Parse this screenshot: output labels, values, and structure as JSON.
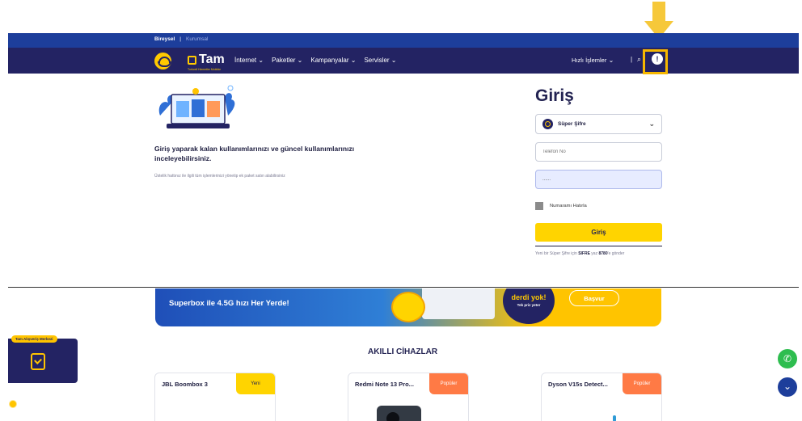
{
  "header": {
    "segments": [
      "Bireysel",
      "|",
      "Kurumsal"
    ],
    "brand": "Tam",
    "brand_tagline": "Turkcell Hizmetler Mobilde",
    "nav": [
      "İnternet",
      "Paketler",
      "Kampanyalar",
      "Servisler"
    ],
    "quick_actions": "Hızlı İşlemler",
    "separator": "|"
  },
  "promo": {
    "title": "Giriş yaparak kalan kullanımlarınızı ve güncel kullanımlarınızı inceleyebilirsiniz.",
    "description": "Üstelik hattınız ile ilgili tüm işlemlerinizi yönetip ek paket satın alabilirsiniz"
  },
  "login": {
    "title": "Giriş",
    "method": "Süper Şifre",
    "phone_placeholder": "Telefon No",
    "password_value": "......",
    "remember_label": "Numaramı Hatırla",
    "button_label": "Giriş",
    "hint_prefix": "Yeni bir Süper Şifre için ",
    "hint_code": "SIFRE",
    "hint_mid": " yaz ",
    "hint_number": "8780",
    "hint_suffix": "'e gönder"
  },
  "banner": {
    "text": "Superbox ile 4.5G hızı Her Yerde!",
    "badge_main": "derdi yok!",
    "badge_sub": "Tek priz yeter",
    "button": "Başvur"
  },
  "market": {
    "label": "Tam Alışveriş Merkezi"
  },
  "devices": {
    "title": "AKILLI CİHAZLAR",
    "cards": [
      {
        "name": "JBL Boombox 3",
        "tag": "Yeni"
      },
      {
        "name": "Redmi Note 13 Pro...",
        "tag": "Popüler"
      },
      {
        "name": "Dyson V15s Detect...",
        "tag": "Popüler"
      }
    ]
  },
  "icons": {
    "search": "search-icon",
    "user": "user-icon",
    "whatsapp": "whatsapp-icon",
    "scroll": "chevron-down-icon",
    "notification": "bell-icon"
  },
  "colors": {
    "nav_bg": "#232363",
    "sub_bar": "#1d3e9b",
    "accent": "#ffd400",
    "highlight": "#f6b700",
    "tag_popular": "#ff7a45"
  }
}
